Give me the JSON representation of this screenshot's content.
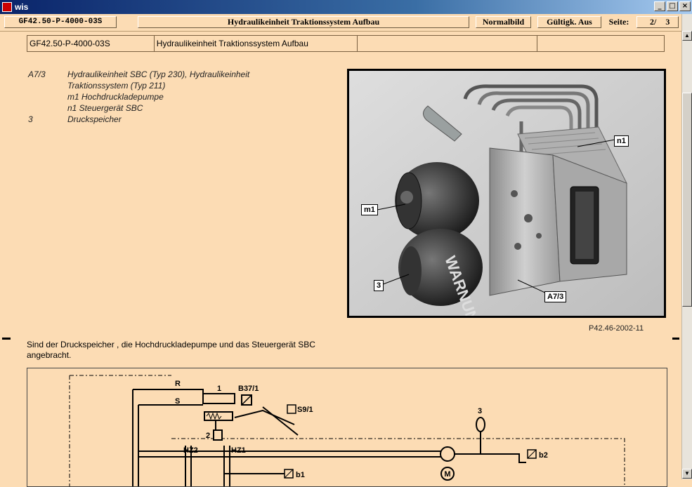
{
  "window": {
    "title": "wis",
    "controls": [
      "_",
      "□",
      "×"
    ]
  },
  "toolbar": {
    "doc_id": "GF42.50-P-4000-03S",
    "doc_title": "Hydraulikeinheit Traktionssystem Aufbau",
    "normalbild": "Normalbild",
    "gueltigkeit": "Gültigk. Aus",
    "seite_label": "Seite:",
    "page_current": "2/",
    "page_total": "3"
  },
  "doc_table": {
    "id": "GF42.50-P-4000-03S",
    "title": "Hydraulikeinheit Traktionssystem Aufbau"
  },
  "legend": [
    {
      "key": "A7/3",
      "text": "Hydraulikeinheit SBC (Typ 230), Hydraulikeinheit"
    },
    {
      "key": "",
      "text": "Traktionssystem (Typ 211)"
    },
    {
      "key": "",
      "text": "m1  Hochdruckladepumpe"
    },
    {
      "key": "",
      "text": "n1   Steuergerät SBC"
    },
    {
      "key": "3",
      "text": "Druckspeicher"
    }
  ],
  "photo": {
    "callouts": {
      "n1": "n1",
      "m1": "m1",
      "three": "3",
      "a73": "A7/3"
    },
    "caption": "P42.46-2002-11",
    "print_text": "WARNUNG"
  },
  "body_text": "Sind der Druckspeicher , die Hochdruckladepumpe und das Steuergerät SBC angebracht.",
  "diagram": {
    "labels": {
      "r": "R",
      "s": "S",
      "one": "1",
      "b371": "B37/1",
      "s91": "S9/1",
      "two": "2",
      "hz2": "HZ2",
      "hz1": "HZ1",
      "three": "3",
      "b2": "b2",
      "b1": "b1",
      "motor": "M"
    }
  },
  "colors": {
    "background": "#fcdcb4",
    "titlebar": "#0a246a",
    "frame": "#000000"
  }
}
